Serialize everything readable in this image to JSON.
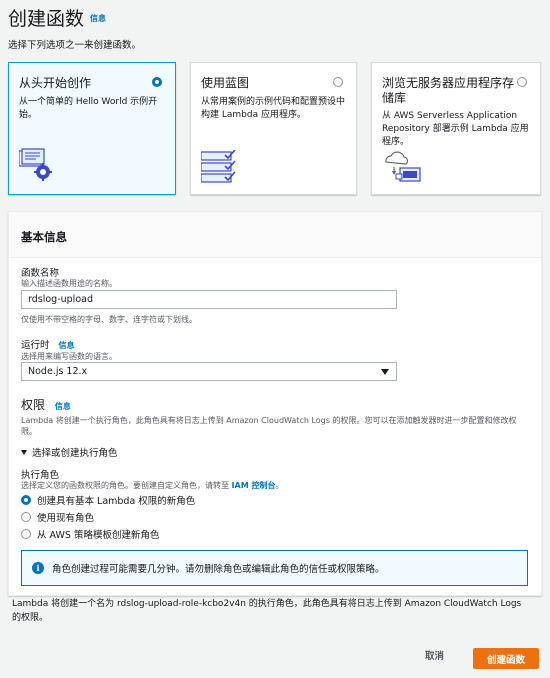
{
  "header": {
    "title": "创建函数",
    "info_link": "信息",
    "subtitle": "选择下列选项之一来创建函数。"
  },
  "options": [
    {
      "title": "从头开始创作",
      "desc": "从一个简单的 Hello World 示例开始。",
      "selected": true
    },
    {
      "title": "使用蓝图",
      "desc": "从常用案例的示例代码和配置预设中构建 Lambda 应用程序。",
      "selected": false
    },
    {
      "title": "浏览无服务器应用程序存储库",
      "desc": "从 AWS Serverless Application Repository 部署示例 Lambda 应用程序。",
      "selected": false
    }
  ],
  "basic_info": {
    "heading": "基本信息",
    "function_name": {
      "label": "函数名称",
      "hint": "输入描述函数用途的名称。",
      "value": "rdslog-upload",
      "rule": "仅使用不带空格的字母、数字、连字符或下划线。"
    },
    "runtime": {
      "label": "运行时",
      "info_link": "信息",
      "hint": "选择用来编写函数的语言。",
      "value": "Node.js 12.x"
    },
    "permissions": {
      "heading": "权限",
      "info_link": "信息",
      "desc": "Lambda 将创建一个执行角色，此角色具有将日志上传到 Amazon CloudWatch Logs 的权限。您可以在添加触发器时进一步配置和修改权限。",
      "expander": "选择或创建执行角色",
      "role_label": "执行角色",
      "role_hint_prefix": "选择定义您的函数权限的角色。要创建自定义角色，请转至",
      "role_hint_link": "IAM 控制台",
      "role_hint_suffix": "。",
      "role_options": [
        {
          "label": "创建具有基本 Lambda 权限的新角色",
          "selected": true
        },
        {
          "label": "使用现有角色",
          "selected": false
        },
        {
          "label": "从 AWS 策略模板创建新角色",
          "selected": false
        }
      ],
      "alert": "角色创建过程可能需要几分钟。请勿删除角色或编辑此角色的信任或权限策略。"
    }
  },
  "footer_note": "Lambda 将创建一个名为 rdslog-upload-role-kcbo2v4n 的执行角色，此角色具有将日志上传到 Amazon CloudWatch Logs 的权限。",
  "actions": {
    "cancel": "取消",
    "create": "创建函数"
  },
  "colors": {
    "accent": "#0073bb",
    "primary_button": "#ec7211",
    "selected_card_bg": "#f1faff"
  }
}
